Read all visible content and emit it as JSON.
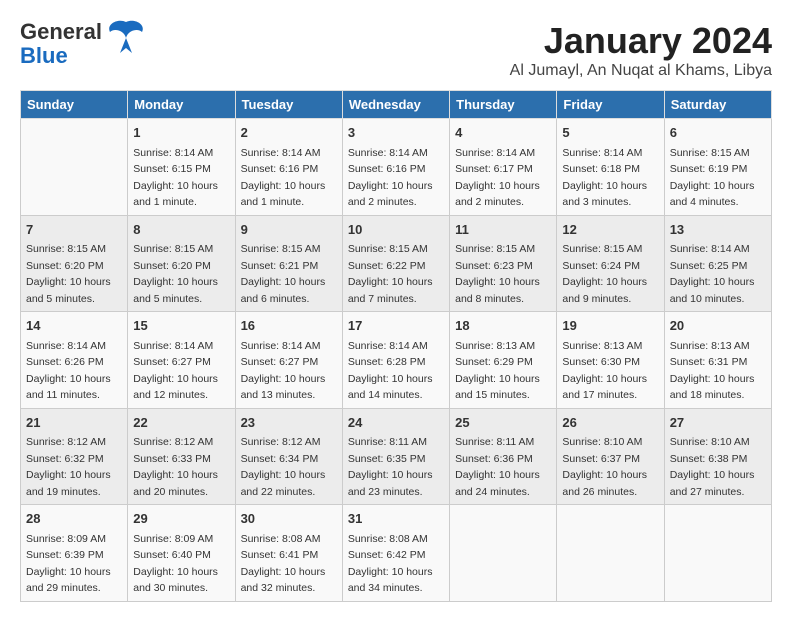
{
  "logo": {
    "line1": "General",
    "line2": "Blue",
    "tagline": "▲"
  },
  "header": {
    "month_title": "January 2024",
    "location": "Al Jumayl, An Nuqat al Khams, Libya"
  },
  "days_of_week": [
    "Sunday",
    "Monday",
    "Tuesday",
    "Wednesday",
    "Thursday",
    "Friday",
    "Saturday"
  ],
  "weeks": [
    [
      {
        "day": "",
        "sunrise": "",
        "sunset": "",
        "daylight": ""
      },
      {
        "day": "1",
        "sunrise": "Sunrise: 8:14 AM",
        "sunset": "Sunset: 6:15 PM",
        "daylight": "Daylight: 10 hours and 1 minute."
      },
      {
        "day": "2",
        "sunrise": "Sunrise: 8:14 AM",
        "sunset": "Sunset: 6:16 PM",
        "daylight": "Daylight: 10 hours and 1 minute."
      },
      {
        "day": "3",
        "sunrise": "Sunrise: 8:14 AM",
        "sunset": "Sunset: 6:16 PM",
        "daylight": "Daylight: 10 hours and 2 minutes."
      },
      {
        "day": "4",
        "sunrise": "Sunrise: 8:14 AM",
        "sunset": "Sunset: 6:17 PM",
        "daylight": "Daylight: 10 hours and 2 minutes."
      },
      {
        "day": "5",
        "sunrise": "Sunrise: 8:14 AM",
        "sunset": "Sunset: 6:18 PM",
        "daylight": "Daylight: 10 hours and 3 minutes."
      },
      {
        "day": "6",
        "sunrise": "Sunrise: 8:15 AM",
        "sunset": "Sunset: 6:19 PM",
        "daylight": "Daylight: 10 hours and 4 minutes."
      }
    ],
    [
      {
        "day": "7",
        "sunrise": "Sunrise: 8:15 AM",
        "sunset": "Sunset: 6:20 PM",
        "daylight": "Daylight: 10 hours and 5 minutes."
      },
      {
        "day": "8",
        "sunrise": "Sunrise: 8:15 AM",
        "sunset": "Sunset: 6:20 PM",
        "daylight": "Daylight: 10 hours and 5 minutes."
      },
      {
        "day": "9",
        "sunrise": "Sunrise: 8:15 AM",
        "sunset": "Sunset: 6:21 PM",
        "daylight": "Daylight: 10 hours and 6 minutes."
      },
      {
        "day": "10",
        "sunrise": "Sunrise: 8:15 AM",
        "sunset": "Sunset: 6:22 PM",
        "daylight": "Daylight: 10 hours and 7 minutes."
      },
      {
        "day": "11",
        "sunrise": "Sunrise: 8:15 AM",
        "sunset": "Sunset: 6:23 PM",
        "daylight": "Daylight: 10 hours and 8 minutes."
      },
      {
        "day": "12",
        "sunrise": "Sunrise: 8:15 AM",
        "sunset": "Sunset: 6:24 PM",
        "daylight": "Daylight: 10 hours and 9 minutes."
      },
      {
        "day": "13",
        "sunrise": "Sunrise: 8:14 AM",
        "sunset": "Sunset: 6:25 PM",
        "daylight": "Daylight: 10 hours and 10 minutes."
      }
    ],
    [
      {
        "day": "14",
        "sunrise": "Sunrise: 8:14 AM",
        "sunset": "Sunset: 6:26 PM",
        "daylight": "Daylight: 10 hours and 11 minutes."
      },
      {
        "day": "15",
        "sunrise": "Sunrise: 8:14 AM",
        "sunset": "Sunset: 6:27 PM",
        "daylight": "Daylight: 10 hours and 12 minutes."
      },
      {
        "day": "16",
        "sunrise": "Sunrise: 8:14 AM",
        "sunset": "Sunset: 6:27 PM",
        "daylight": "Daylight: 10 hours and 13 minutes."
      },
      {
        "day": "17",
        "sunrise": "Sunrise: 8:14 AM",
        "sunset": "Sunset: 6:28 PM",
        "daylight": "Daylight: 10 hours and 14 minutes."
      },
      {
        "day": "18",
        "sunrise": "Sunrise: 8:13 AM",
        "sunset": "Sunset: 6:29 PM",
        "daylight": "Daylight: 10 hours and 15 minutes."
      },
      {
        "day": "19",
        "sunrise": "Sunrise: 8:13 AM",
        "sunset": "Sunset: 6:30 PM",
        "daylight": "Daylight: 10 hours and 17 minutes."
      },
      {
        "day": "20",
        "sunrise": "Sunrise: 8:13 AM",
        "sunset": "Sunset: 6:31 PM",
        "daylight": "Daylight: 10 hours and 18 minutes."
      }
    ],
    [
      {
        "day": "21",
        "sunrise": "Sunrise: 8:12 AM",
        "sunset": "Sunset: 6:32 PM",
        "daylight": "Daylight: 10 hours and 19 minutes."
      },
      {
        "day": "22",
        "sunrise": "Sunrise: 8:12 AM",
        "sunset": "Sunset: 6:33 PM",
        "daylight": "Daylight: 10 hours and 20 minutes."
      },
      {
        "day": "23",
        "sunrise": "Sunrise: 8:12 AM",
        "sunset": "Sunset: 6:34 PM",
        "daylight": "Daylight: 10 hours and 22 minutes."
      },
      {
        "day": "24",
        "sunrise": "Sunrise: 8:11 AM",
        "sunset": "Sunset: 6:35 PM",
        "daylight": "Daylight: 10 hours and 23 minutes."
      },
      {
        "day": "25",
        "sunrise": "Sunrise: 8:11 AM",
        "sunset": "Sunset: 6:36 PM",
        "daylight": "Daylight: 10 hours and 24 minutes."
      },
      {
        "day": "26",
        "sunrise": "Sunrise: 8:10 AM",
        "sunset": "Sunset: 6:37 PM",
        "daylight": "Daylight: 10 hours and 26 minutes."
      },
      {
        "day": "27",
        "sunrise": "Sunrise: 8:10 AM",
        "sunset": "Sunset: 6:38 PM",
        "daylight": "Daylight: 10 hours and 27 minutes."
      }
    ],
    [
      {
        "day": "28",
        "sunrise": "Sunrise: 8:09 AM",
        "sunset": "Sunset: 6:39 PM",
        "daylight": "Daylight: 10 hours and 29 minutes."
      },
      {
        "day": "29",
        "sunrise": "Sunrise: 8:09 AM",
        "sunset": "Sunset: 6:40 PM",
        "daylight": "Daylight: 10 hours and 30 minutes."
      },
      {
        "day": "30",
        "sunrise": "Sunrise: 8:08 AM",
        "sunset": "Sunset: 6:41 PM",
        "daylight": "Daylight: 10 hours and 32 minutes."
      },
      {
        "day": "31",
        "sunrise": "Sunrise: 8:08 AM",
        "sunset": "Sunset: 6:42 PM",
        "daylight": "Daylight: 10 hours and 34 minutes."
      },
      {
        "day": "",
        "sunrise": "",
        "sunset": "",
        "daylight": ""
      },
      {
        "day": "",
        "sunrise": "",
        "sunset": "",
        "daylight": ""
      },
      {
        "day": "",
        "sunrise": "",
        "sunset": "",
        "daylight": ""
      }
    ]
  ]
}
